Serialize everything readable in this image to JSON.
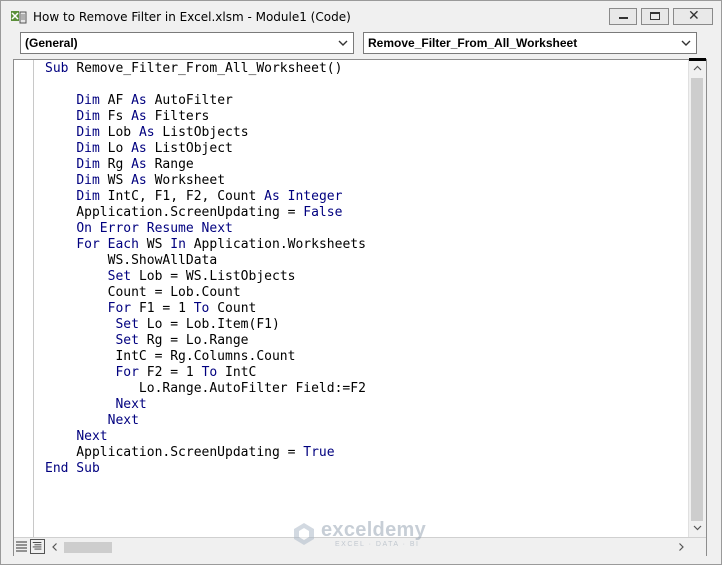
{
  "window": {
    "title": "How to Remove Filter in Excel.xlsm - Module1 (Code)",
    "icon": "vba-code-window-icon"
  },
  "controls": {
    "minimize": "minimize",
    "maximize": "maximize",
    "close": "✕"
  },
  "object_combo": {
    "value": "(General)"
  },
  "procedure_combo": {
    "value": "Remove_Filter_From_All_Worksheet"
  },
  "code_lines": [
    [
      {
        "t": "Sub ",
        "k": true
      },
      {
        "t": "Remove_Filter_From_All_Worksheet()"
      }
    ],
    [
      {
        "t": ""
      }
    ],
    [
      {
        "t": "    "
      },
      {
        "t": "Dim ",
        "k": true
      },
      {
        "t": "AF "
      },
      {
        "t": "As ",
        "k": true
      },
      {
        "t": "AutoFilter"
      }
    ],
    [
      {
        "t": "    "
      },
      {
        "t": "Dim ",
        "k": true
      },
      {
        "t": "Fs "
      },
      {
        "t": "As ",
        "k": true
      },
      {
        "t": "Filters"
      }
    ],
    [
      {
        "t": "    "
      },
      {
        "t": "Dim ",
        "k": true
      },
      {
        "t": "Lob "
      },
      {
        "t": "As ",
        "k": true
      },
      {
        "t": "ListObjects"
      }
    ],
    [
      {
        "t": "    "
      },
      {
        "t": "Dim ",
        "k": true
      },
      {
        "t": "Lo "
      },
      {
        "t": "As ",
        "k": true
      },
      {
        "t": "ListObject"
      }
    ],
    [
      {
        "t": "    "
      },
      {
        "t": "Dim ",
        "k": true
      },
      {
        "t": "Rg "
      },
      {
        "t": "As ",
        "k": true
      },
      {
        "t": "Range"
      }
    ],
    [
      {
        "t": "    "
      },
      {
        "t": "Dim ",
        "k": true
      },
      {
        "t": "WS "
      },
      {
        "t": "As ",
        "k": true
      },
      {
        "t": "Worksheet"
      }
    ],
    [
      {
        "t": "    "
      },
      {
        "t": "Dim ",
        "k": true
      },
      {
        "t": "IntC, F1, F2, Count "
      },
      {
        "t": "As Integer",
        "k": true
      }
    ],
    [
      {
        "t": "    Application.ScreenUpdating = "
      },
      {
        "t": "False",
        "k": true
      }
    ],
    [
      {
        "t": "    "
      },
      {
        "t": "On Error Resume Next",
        "k": true
      }
    ],
    [
      {
        "t": "    "
      },
      {
        "t": "For Each ",
        "k": true
      },
      {
        "t": "WS "
      },
      {
        "t": "In ",
        "k": true
      },
      {
        "t": "Application.Worksheets"
      }
    ],
    [
      {
        "t": "        WS.ShowAllData"
      }
    ],
    [
      {
        "t": "        "
      },
      {
        "t": "Set ",
        "k": true
      },
      {
        "t": "Lob = WS.ListObjects"
      }
    ],
    [
      {
        "t": "        Count = Lob.Count"
      }
    ],
    [
      {
        "t": "        "
      },
      {
        "t": "For ",
        "k": true
      },
      {
        "t": "F1 = 1 "
      },
      {
        "t": "To ",
        "k": true
      },
      {
        "t": "Count"
      }
    ],
    [
      {
        "t": "         "
      },
      {
        "t": "Set ",
        "k": true
      },
      {
        "t": "Lo = Lob.Item(F1)"
      }
    ],
    [
      {
        "t": "         "
      },
      {
        "t": "Set ",
        "k": true
      },
      {
        "t": "Rg = Lo.Range"
      }
    ],
    [
      {
        "t": "         IntC = Rg.Columns.Count"
      }
    ],
    [
      {
        "t": "         "
      },
      {
        "t": "For ",
        "k": true
      },
      {
        "t": "F2 = 1 "
      },
      {
        "t": "To ",
        "k": true
      },
      {
        "t": "IntC"
      }
    ],
    [
      {
        "t": "            Lo.Range.AutoFilter Field:=F2"
      }
    ],
    [
      {
        "t": "         "
      },
      {
        "t": "Next",
        "k": true
      }
    ],
    [
      {
        "t": "        "
      },
      {
        "t": "Next",
        "k": true
      }
    ],
    [
      {
        "t": "    "
      },
      {
        "t": "Next",
        "k": true
      }
    ],
    [
      {
        "t": "    Application.ScreenUpdating = "
      },
      {
        "t": "True",
        "k": true
      }
    ],
    [
      {
        "t": "End Sub",
        "k": true
      }
    ]
  ],
  "watermark": {
    "name": "exceldemy",
    "tagline": "EXCEL · DATA · BI",
    "icon": "exceldemy-logo-icon"
  },
  "colors": {
    "keyword": "#00007f",
    "text": "#000000"
  }
}
